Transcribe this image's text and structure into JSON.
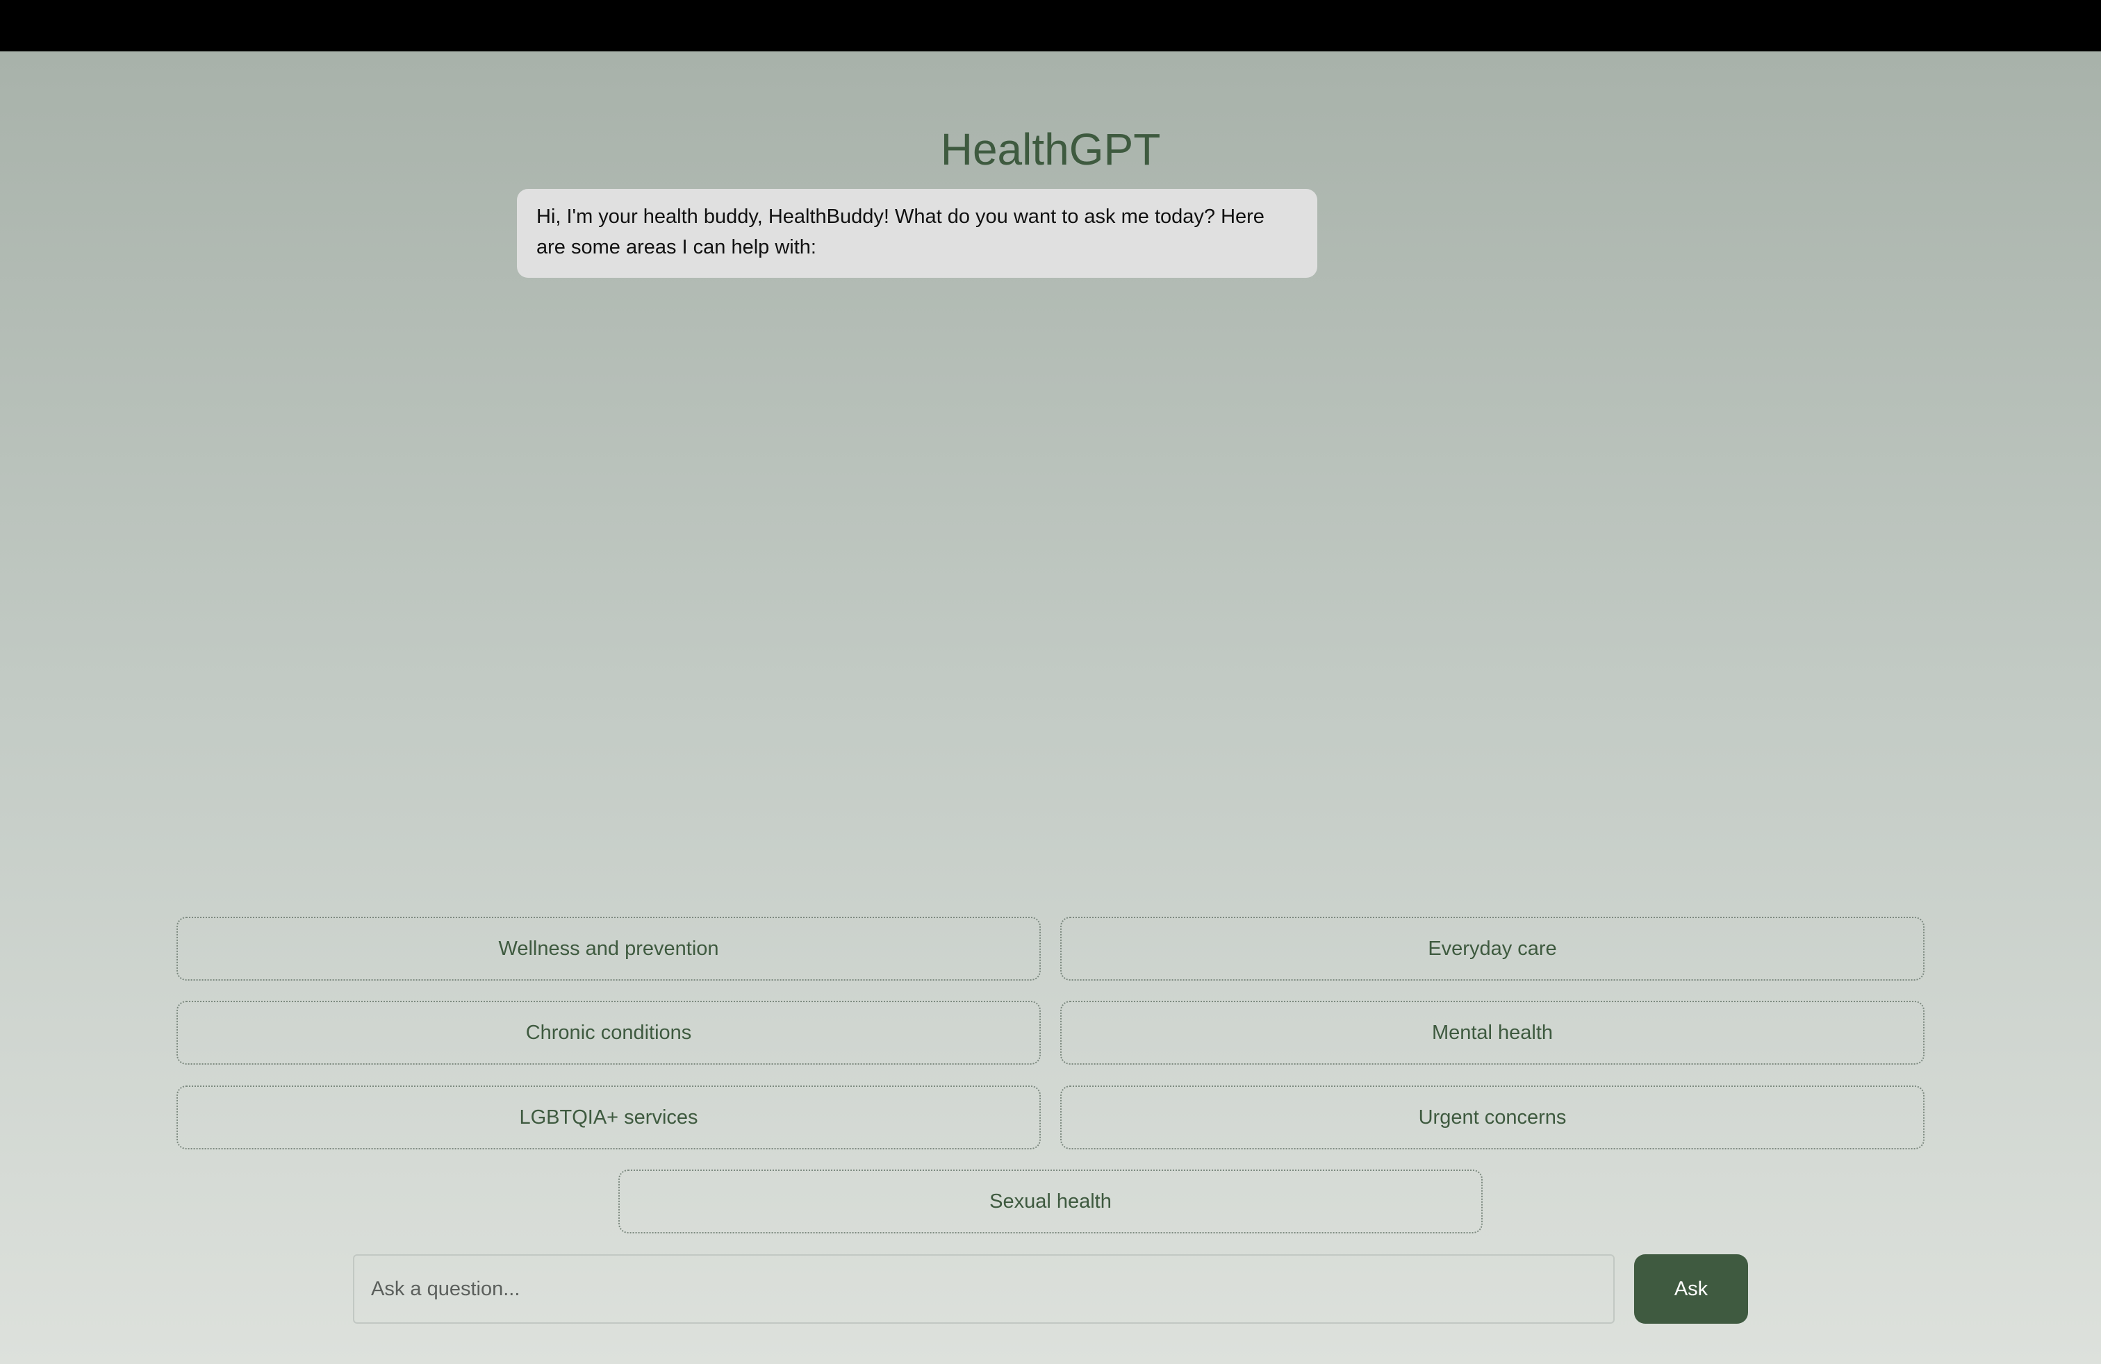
{
  "header": {
    "title": "HealthGPT"
  },
  "chat": {
    "messages": [
      {
        "role": "assistant",
        "text": "Hi, I'm your health buddy, HealthBuddy! What do you want to ask me today? Here are some areas I can help with:"
      }
    ]
  },
  "topics": [
    {
      "label": "Wellness and prevention"
    },
    {
      "label": "Everyday care"
    },
    {
      "label": "Chronic conditions"
    },
    {
      "label": "Mental health"
    },
    {
      "label": "LGBTQIA+ services"
    },
    {
      "label": "Urgent concerns"
    },
    {
      "label": "Sexual health"
    }
  ],
  "composer": {
    "placeholder": "Ask a question...",
    "value": "",
    "submit_label": "Ask"
  },
  "colors": {
    "accent": "#3f5a40",
    "title": "#3e5a3f",
    "bubble_bg": "#e0e0e0"
  }
}
